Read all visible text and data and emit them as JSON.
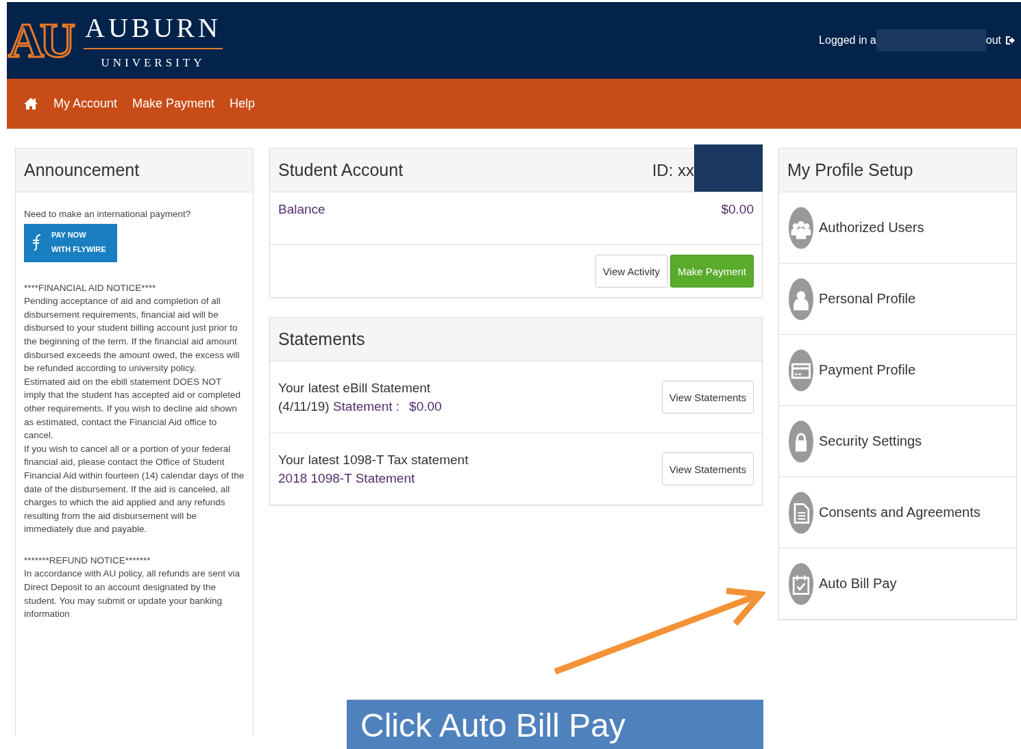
{
  "header": {
    "logo_mark": "AU",
    "logo_word": "AUBURN",
    "logo_subword": "UNIVERSITY",
    "login_prefix": "Logged in a",
    "login_suffix": "out"
  },
  "nav": [
    {
      "label": "My Account"
    },
    {
      "label": "Make Payment"
    },
    {
      "label": "Help"
    }
  ],
  "announcement": {
    "title": "Announcement",
    "intro": "Need to make an international payment?",
    "flywire_button": [
      "PAY NOW",
      "WITH FLYWIRE"
    ],
    "notices": [
      {
        "heading": "****FINANCIAL AID NOTICE****",
        "paragraphs": [
          "Pending acceptance of aid and completion of all disbursement requirements, financial aid will be disbursed to your student billing account just prior to the beginning of the term. If the financial aid amount disbursed exceeds the amount owed, the excess will be refunded according to university policy.",
          "Estimated aid on the ebill statement DOES NOT imply that the student has accepted aid or completed other requirements. If you wish to decline aid shown as estimated, contact the Financial Aid office to cancel.",
          "If you wish to cancel all or a portion of your federal financial aid, please contact the Office of Student Financial Aid within fourteen (14) calendar days of the date of the disbursement. If the aid is canceled, all charges to which the aid applied and any refunds resulting from the aid disbursement will be immediately due and payable."
        ]
      },
      {
        "heading": "*******REFUND NOTICE*******",
        "paragraphs": [
          "In accordance with AU policy, all refunds are sent via Direct Deposit to an account designated by the student. You may submit or update your banking information"
        ]
      }
    ]
  },
  "student_account": {
    "title": "Student Account",
    "id_label": "ID: xx",
    "balance_label": "Balance",
    "balance_value": "$0.00",
    "buttons": [
      {
        "label": "View Activity",
        "kind": "default"
      },
      {
        "label": "Make Payment",
        "kind": "primary"
      }
    ]
  },
  "statements": {
    "title": "Statements",
    "items": [
      {
        "heading": "Your latest eBill Statement",
        "date": "(4/11/19)",
        "link": "Statement :",
        "amount": "$0.00",
        "button": "View Statements"
      },
      {
        "heading": "Your latest 1098-T Tax statement",
        "link": "2018 1098-T Statement",
        "button": "View Statements"
      }
    ]
  },
  "profile": {
    "title": "My Profile Setup",
    "items": [
      {
        "label": "Authorized Users",
        "kind": "users"
      },
      {
        "label": "Personal Profile",
        "kind": "person"
      },
      {
        "label": "Payment Profile",
        "kind": "card"
      },
      {
        "label": "Security Settings",
        "kind": "lock"
      },
      {
        "label": "Consents and Agreements",
        "kind": "document"
      },
      {
        "label": "Auto Bill Pay",
        "kind": "calendar"
      }
    ]
  },
  "callout": {
    "text": "Click Auto Bill Pay"
  }
}
